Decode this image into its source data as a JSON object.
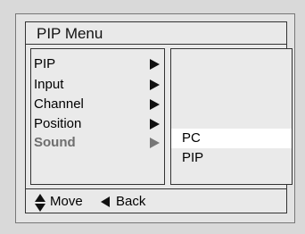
{
  "menu": {
    "title": "PIP Menu",
    "items": [
      {
        "label": "PIP",
        "selected": false
      },
      {
        "label": "Input",
        "selected": false
      },
      {
        "label": "Channel",
        "selected": false
      },
      {
        "label": "Position",
        "selected": false
      },
      {
        "label": "Sound",
        "selected": true
      }
    ],
    "submenu": [
      {
        "label": "PC",
        "highlighted": true
      },
      {
        "label": "PIP",
        "highlighted": false
      }
    ]
  },
  "footer": {
    "move_icon": "up-down-arrows-icon",
    "move_label": "Move",
    "back_icon": "left-arrow-icon",
    "back_label": "Back"
  },
  "colors": {
    "background": "#d9d9d9",
    "panel": "#eaeaea",
    "selected_text": "#6e6e6e",
    "highlight": "#ffffff"
  }
}
